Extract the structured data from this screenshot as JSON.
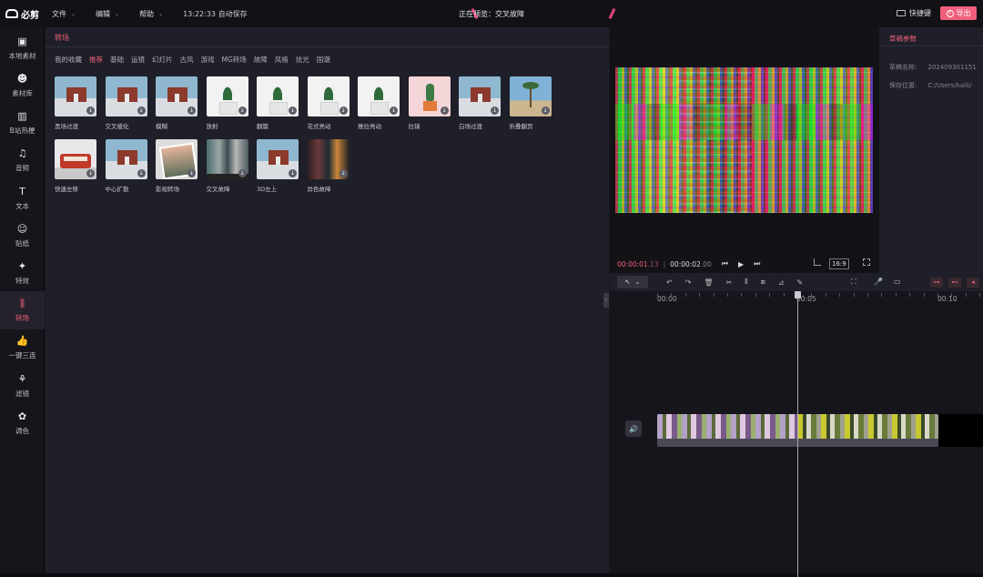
{
  "app": {
    "logo_text": "必剪",
    "menu": [
      "文件",
      "编辑",
      "帮助"
    ],
    "autosave": "13:22:33 自动保存",
    "preview_title": "正在预览：交叉故障",
    "shortcut_label": "快捷键",
    "export_label": "导出"
  },
  "sidebar": {
    "items": [
      {
        "label": "本地素材",
        "icon": "folder-icon"
      },
      {
        "label": "素材库",
        "icon": "library-icon"
      },
      {
        "label": "B站热梗",
        "icon": "tv-icon"
      },
      {
        "label": "音频",
        "icon": "music-icon"
      },
      {
        "label": "文本",
        "icon": "text-icon"
      },
      {
        "label": "贴纸",
        "icon": "sticker-icon"
      },
      {
        "label": "特效",
        "icon": "effects-icon"
      },
      {
        "label": "转场",
        "icon": "transition-icon"
      },
      {
        "label": "一键三连",
        "icon": "thumbs-up-icon"
      },
      {
        "label": "滤镜",
        "icon": "filter-icon"
      },
      {
        "label": "调色",
        "icon": "palette-icon"
      }
    ],
    "active_index": 7
  },
  "panel": {
    "tab": "转场",
    "categories": [
      "我的收藏",
      "推荐",
      "基础",
      "运镜",
      "幻灯片",
      "古风",
      "游戏",
      "MG转场",
      "故障",
      "风格",
      "炫光",
      "国潮"
    ],
    "selected_category": 1,
    "thumbnails": [
      {
        "label": "黑场过渡",
        "style": "house"
      },
      {
        "label": "交叉缓化",
        "style": "house"
      },
      {
        "label": "模糊",
        "style": "house"
      },
      {
        "label": "放射",
        "style": "plant"
      },
      {
        "label": "翻篇",
        "style": "plant"
      },
      {
        "label": "花式亮动",
        "style": "plant"
      },
      {
        "label": "推拉亮动",
        "style": "plant"
      },
      {
        "label": "拉镜",
        "style": "cactus"
      },
      {
        "label": "白场过渡",
        "style": "house"
      },
      {
        "label": "折叠翻页",
        "style": "palm"
      },
      {
        "label": "快速左移",
        "style": "bus"
      },
      {
        "label": "中心扩散",
        "style": "house"
      },
      {
        "label": "影视转场",
        "style": "film"
      },
      {
        "label": "交叉故障",
        "style": "city"
      },
      {
        "label": "3D左上",
        "style": "house"
      },
      {
        "label": "异色故障",
        "style": "dark"
      }
    ]
  },
  "player": {
    "current_time": "00:00:01",
    "current_frames": ".13",
    "separator": "|",
    "total_time": "00:00:02",
    "total_frames": ".00",
    "ratio": "16:9"
  },
  "draft": {
    "title": "草稿参数",
    "name_label": "草稿名称:",
    "name_value": "202409301151",
    "path_label": "保存位置:",
    "path_value": "C:/Users/kaili/"
  },
  "timeline": {
    "ruler_labels": [
      "00:00",
      "00:05",
      "00:10"
    ]
  },
  "colors": {
    "accent": "#f0607c",
    "background": "#18181f"
  }
}
